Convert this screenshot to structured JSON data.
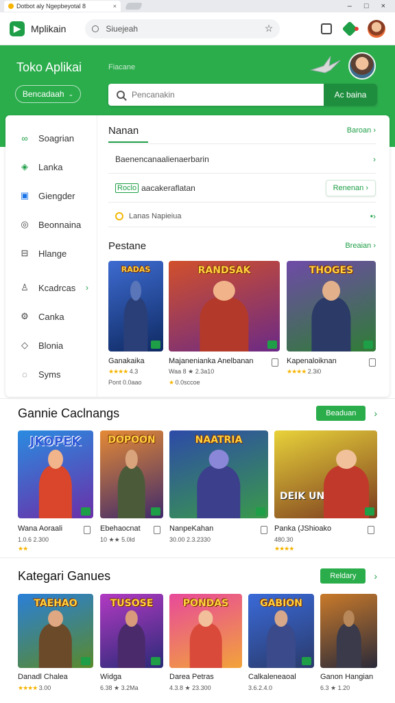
{
  "browser": {
    "tab_title": "Dotbot aly Ngepbeyotal 8",
    "tab_close": "×",
    "win_controls": [
      "–",
      "□",
      "×"
    ]
  },
  "appbar": {
    "brand": "Mplikain",
    "url_text": "Siuejeah"
  },
  "hero": {
    "title": "Toko Aplikai",
    "subtitle": "Fiacane",
    "select_label": "Bencadaah",
    "search_placeholder": "Pencanakin",
    "search_button": "Ac baina"
  },
  "sidebar": {
    "items": [
      {
        "label": "Soagrian",
        "icon": "gamepad-icon"
      },
      {
        "label": "Lanka",
        "icon": "tag-icon"
      },
      {
        "label": "Giengder",
        "icon": "grid-icon"
      },
      {
        "label": "Beonnaina",
        "icon": "shield-icon"
      },
      {
        "label": "Hlange",
        "icon": "box-icon"
      },
      {
        "label": "Kcadrcas",
        "icon": "person-icon"
      },
      {
        "label": "Canka",
        "icon": "gear-icon"
      },
      {
        "label": "Blonia",
        "icon": "tag-outline-icon"
      },
      {
        "label": "Syms",
        "icon": "chat-icon"
      }
    ]
  },
  "main": {
    "header_title": "Nanan",
    "header_link": "Baroan",
    "row1": "Baenencanaalienaerbarin",
    "row2_tag": "Roclo",
    "row2_text": "aacakeraflatan",
    "row2_button": "Renenan",
    "row3": "Lanas Napieiua",
    "popular_title": "Pestane",
    "popular_link": "Breaian",
    "popular_items": [
      {
        "art": "RADAS",
        "name": "Ganakaika",
        "rating": "4.3",
        "meta": "Pont 0.0aao"
      },
      {
        "art": "RANDSAK",
        "name": "Majanenianka Anelbanan",
        "rating": "Waa 8 ★ 2.3a10",
        "meta": "0.0sccoe"
      },
      {
        "art": "THOGES",
        "name": "Kapenaloiknan",
        "rating": "2.3i0",
        "meta": ""
      }
    ]
  },
  "games_section": {
    "title": "Gannie Caclnangs",
    "button": "Beaduan",
    "items": [
      {
        "art": "JKOPEK",
        "name": "Wana Aoraali",
        "rating": "1.0.6 2.300"
      },
      {
        "art": "DOPOON",
        "name": "Ebehaocnat",
        "rating": "10 ★★ 5.0ld"
      },
      {
        "art": "NAATRIA",
        "name": "NanpeKahan",
        "rating": "30.00 2.3.2330"
      },
      {
        "art": "DEIK UNICH",
        "name": "Panka (JShioako",
        "rating": "480.30"
      }
    ]
  },
  "category_section": {
    "title": "Kategari Ganues",
    "button": "Reldary",
    "items": [
      {
        "art": "TAEHAO",
        "name": "Danadl Chalea",
        "rating": "3.00"
      },
      {
        "art": "TUSOSE",
        "name": "Widga",
        "rating": "6.38 ★ 3.2Ma"
      },
      {
        "art": "PONDAS",
        "name": "Darea Petras",
        "rating": "4.3.8 ★ 23.300"
      },
      {
        "art": "GABION",
        "name": "Calkaleneaoal",
        "rating": "3.6.2.4.0"
      },
      {
        "art": "",
        "name": "Ganon Hangian",
        "rating": "6.3 ★ 1.20"
      }
    ]
  },
  "colors": {
    "accent": "#2bad4c",
    "accent_dark": "#1e8e3e",
    "star": "#f5b400"
  }
}
